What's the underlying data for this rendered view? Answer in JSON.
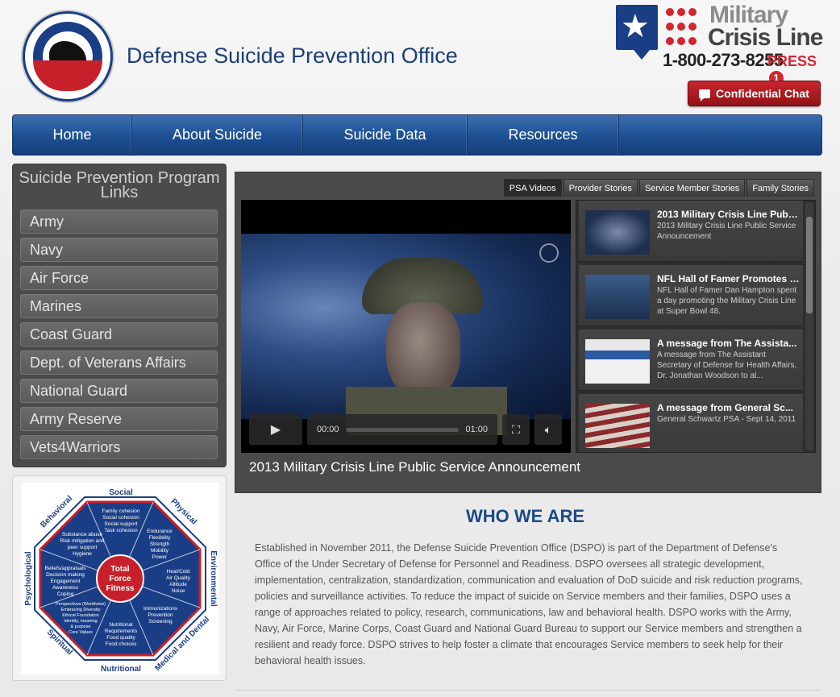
{
  "header": {
    "site_title": "Defense Suicide Prevention Office",
    "seal_text": "DEFENSE SUICIDE PREVENTION OFFICE",
    "crisis_line": {
      "line1": "Military",
      "line2": "Crisis Line",
      "phone": "1-800-273-8255",
      "press": "PRESS",
      "press_number": "1"
    },
    "chat_button": "Confidential Chat"
  },
  "nav": {
    "items": [
      {
        "label": "Home"
      },
      {
        "label": "About Suicide"
      },
      {
        "label": "Suicide Data"
      },
      {
        "label": "Resources"
      }
    ]
  },
  "sidebar": {
    "title": "Suicide Prevention Program Links",
    "links": [
      {
        "label": "Army"
      },
      {
        "label": "Navy"
      },
      {
        "label": "Air Force"
      },
      {
        "label": "Marines"
      },
      {
        "label": "Coast Guard"
      },
      {
        "label": "Dept. of Veterans Affairs"
      },
      {
        "label": "National Guard"
      },
      {
        "label": "Army Reserve"
      },
      {
        "label": "Vets4Warriors"
      }
    ]
  },
  "fitness": {
    "center": [
      "Total",
      "Force",
      "Fitness"
    ],
    "domains": {
      "social": "Social",
      "physical": "Physical",
      "environmental": "Environmental",
      "medical": "Medical and Dental",
      "nutritional": "Nutritional",
      "spiritual": "Spiritual",
      "psychological": "Psychological",
      "behavioral": "Behavioral"
    },
    "items": {
      "social": [
        "Family cohesion",
        "Social cohesion",
        "Social support",
        "Task cohesion"
      ],
      "physical": [
        "Endurance",
        "Flexibility",
        "Strength",
        "Mobility",
        "Power"
      ],
      "environmental": [
        "Heat/Cold",
        "Air Quality",
        "Altitude",
        "Noise"
      ],
      "medical": [
        "Immunizations",
        "Prevention",
        "Screening"
      ],
      "nutritional": [
        "Nutritional",
        "Requirements",
        "Food quality",
        "Food choices"
      ],
      "spiritual": [
        "Perspectives (Worldview)",
        "Embracing Diversity",
        "Ethical Foundation",
        "Identity, meaning",
        "& purpose",
        "Core Values"
      ],
      "psychological": [
        "Beliefs/appraisals",
        "Decision making",
        "Engagement",
        "Awareness",
        "Coping"
      ],
      "behavioral": [
        "Substance abuse",
        "Risk mitigation and",
        "peer support",
        "Hygiene"
      ]
    }
  },
  "video": {
    "tabs": [
      {
        "label": "PSA Videos"
      },
      {
        "label": "Provider Stories"
      },
      {
        "label": "Service Member Stories"
      },
      {
        "label": "Family Stories"
      }
    ],
    "current_time": "00:00",
    "duration": "01:00",
    "caption": "2013 Military Crisis Line Public Service Announcement",
    "playlist": [
      {
        "title": "2013 Military Crisis Line Publi...",
        "desc": "2013 Military Crisis Line Public Service Announcement"
      },
      {
        "title": "NFL Hall of Famer Promotes M...",
        "desc": "NFL Hall of Famer Dan Hampton spent a day promoting the Military Crisis Line at Super Bowl 48."
      },
      {
        "title": "A message from The Assista...",
        "desc": "A message from The Assistant Secretary of Defense for Health Affairs, Dr. Jonathan Woodson to al..."
      },
      {
        "title": "A message from General Sc...",
        "desc": "General Schwartz PSA - Sept 14, 2011"
      }
    ]
  },
  "who": {
    "title": "WHO WE ARE",
    "body": "Established in November 2011, the Defense Suicide Prevention Office (DSPO) is part of the Department of Defense's Office of the Under Secretary of Defense for Personnel and Readiness. DSPO oversees all strategic development, implementation, centralization, standardization, communication and evaluation of DoD suicide and risk reduction programs, policies and surveillance activities. To reduce the impact of suicide on Service members and their families, DSPO uses a range of approaches related to policy, research, communications, law and behavioral health. DSPO works with the Army, Navy, Air Force, Marine Corps, Coast Guard and National Guard Bureau to support our Service members and strengthen a resilient and ready force. DSPO strives to help foster a climate that encourages Service members to seek help for their behavioral health issues."
  }
}
